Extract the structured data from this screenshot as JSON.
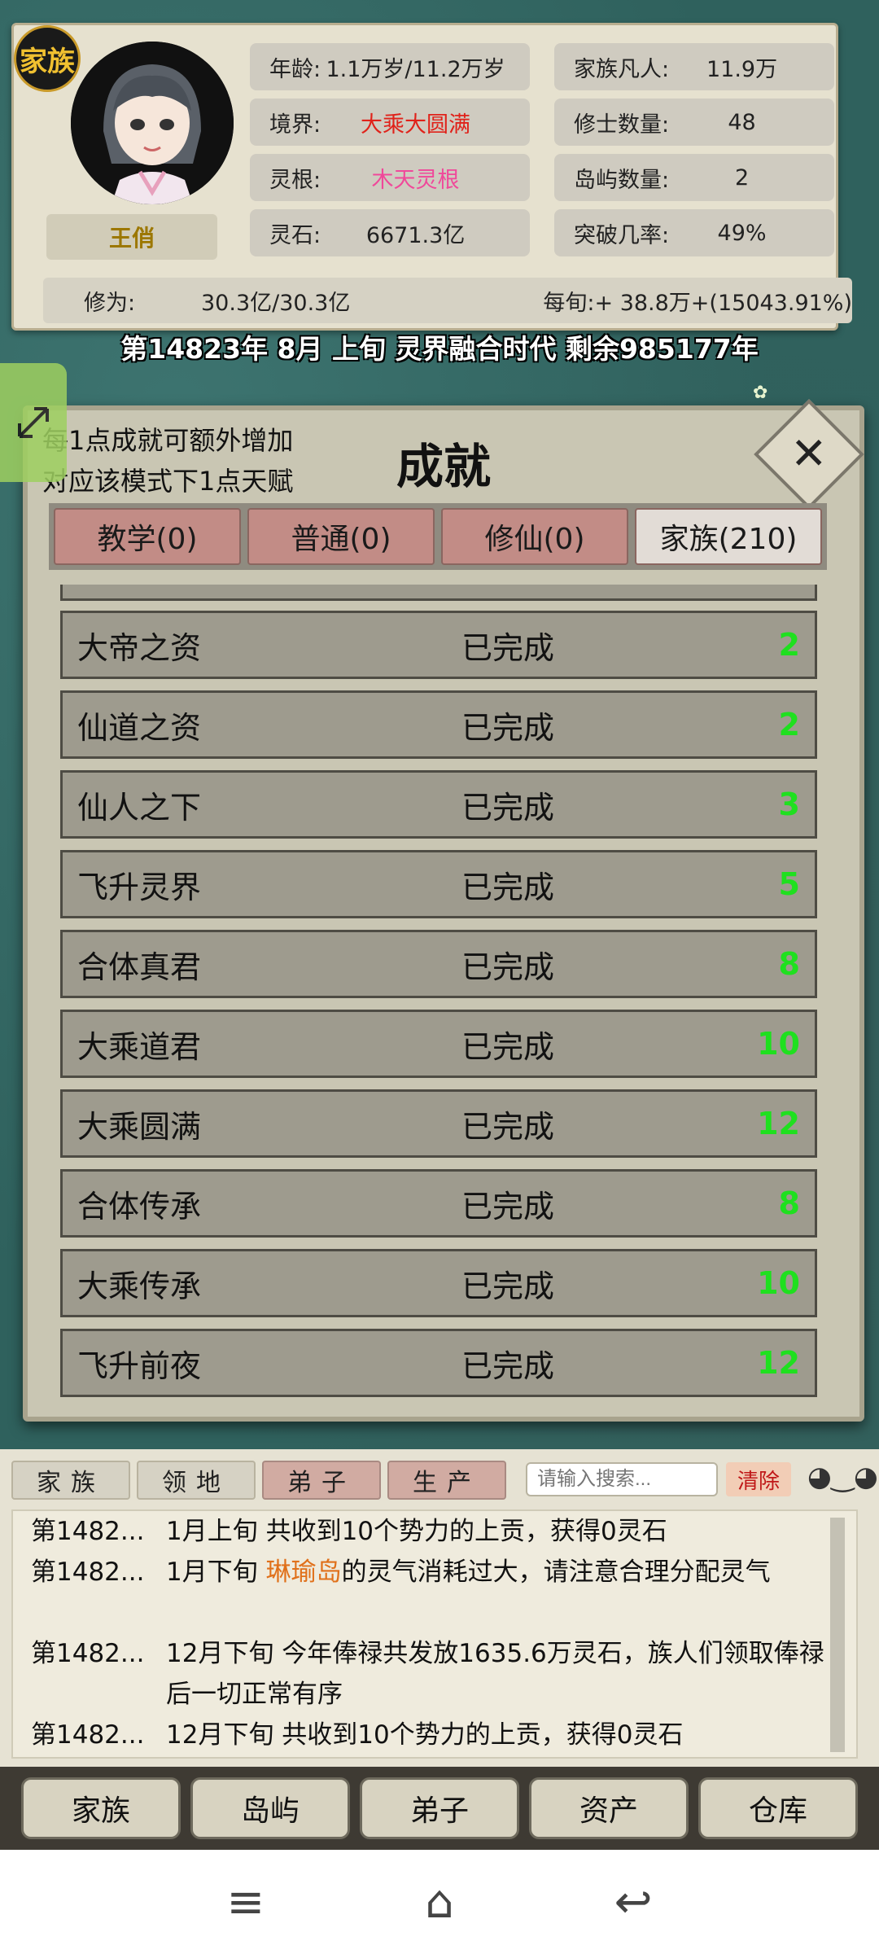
{
  "header": {
    "clan_badge": "家族",
    "character_name": "王俏",
    "stats_left": [
      {
        "label": "年龄:",
        "value": "1.1万岁/11.2万岁"
      },
      {
        "label": "境界:",
        "value": "大乘大圆满",
        "color": "#e0221a"
      },
      {
        "label": "灵根:",
        "value": "木天灵根",
        "color": "#f0489a"
      },
      {
        "label": "灵石:",
        "value": "6671.3亿"
      }
    ],
    "stats_right": [
      {
        "label": "家族凡人:",
        "value": "11.9万"
      },
      {
        "label": "修士数量:",
        "value": "48"
      },
      {
        "label": "岛屿数量:",
        "value": "2"
      },
      {
        "label": "突破几率:",
        "value": "49%"
      }
    ],
    "cultivation_label": "修为:",
    "cultivation_value": "30.3亿/30.3亿",
    "per_period": "每旬:+ 38.8万+(15043.91%)",
    "date_line": "第14823年 8月 上旬 灵界融合时代 剩余985177年"
  },
  "dialog": {
    "title": "成就",
    "hint_line1": "每1点成就可额外增加",
    "hint_line2": "对应该模式下1点天赋",
    "close_icon": "close-icon",
    "tabs": [
      {
        "label": "教学(0)",
        "active": false
      },
      {
        "label": "普通(0)",
        "active": false
      },
      {
        "label": "修仙(0)",
        "active": false
      },
      {
        "label": "家族(210)",
        "active": true
      }
    ],
    "achievements": [
      {
        "name": "大帝之资",
        "status": "已完成",
        "points": "2"
      },
      {
        "name": "仙道之资",
        "status": "已完成",
        "points": "2"
      },
      {
        "name": "仙人之下",
        "status": "已完成",
        "points": "3"
      },
      {
        "name": "飞升灵界",
        "status": "已完成",
        "points": "5"
      },
      {
        "name": "合体真君",
        "status": "已完成",
        "points": "8"
      },
      {
        "name": "大乘道君",
        "status": "已完成",
        "points": "10"
      },
      {
        "name": "大乘圆满",
        "status": "已完成",
        "points": "12"
      },
      {
        "name": "合体传承",
        "status": "已完成",
        "points": "8"
      },
      {
        "name": "大乘传承",
        "status": "已完成",
        "points": "10"
      },
      {
        "name": "飞升前夜",
        "status": "已完成",
        "points": "12"
      }
    ]
  },
  "log": {
    "tabs": [
      "家族",
      "领地",
      "弟子",
      "生产"
    ],
    "search_placeholder": "请输入搜索...",
    "clear_label": "清除",
    "entries": [
      {
        "date": "第1482...",
        "text_pre": "1月上旬 共收到10个势力的上贡，获得0灵石",
        "highlight": "",
        "text_post": ""
      },
      {
        "date": "第1482...",
        "text_pre": "1月下旬 ",
        "highlight": "琳瑜岛",
        "text_post": "的灵气消耗过大，请注意合理分配灵气"
      },
      {
        "date": "第1482...",
        "text_pre": "12月下旬 今年俸禄共发放1635.6万灵石，族人们领取俸禄后一切正常有序",
        "highlight": "",
        "text_post": ""
      },
      {
        "date": "第1482...",
        "text_pre": "12月下旬 共收到10个势力的上贡，获得0灵石",
        "highlight": "",
        "text_post": ""
      }
    ]
  },
  "nav": [
    "家族",
    "岛屿",
    "弟子",
    "资产",
    "仓库"
  ],
  "system_bar": [
    "menu-icon",
    "home-icon",
    "back-icon"
  ]
}
